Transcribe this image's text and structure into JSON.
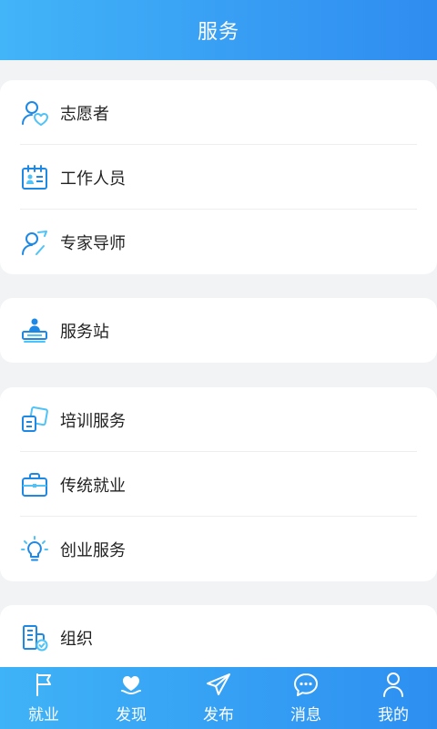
{
  "header": {
    "title": "服务"
  },
  "groups": [
    {
      "items": [
        {
          "label": "志愿者",
          "icon": "volunteer-icon"
        },
        {
          "label": "工作人员",
          "icon": "staff-badge-icon"
        },
        {
          "label": "专家导师",
          "icon": "expert-mentor-icon"
        }
      ]
    },
    {
      "items": [
        {
          "label": "服务站",
          "icon": "service-station-icon"
        }
      ]
    },
    {
      "items": [
        {
          "label": "培训服务",
          "icon": "training-icon"
        },
        {
          "label": "传统就业",
          "icon": "briefcase-icon"
        },
        {
          "label": "创业服务",
          "icon": "lightbulb-icon"
        }
      ]
    },
    {
      "items": [
        {
          "label": "组织",
          "icon": "organization-icon"
        }
      ]
    }
  ],
  "tabbar": {
    "tabs": [
      {
        "label": "就业",
        "icon": "flag-icon"
      },
      {
        "label": "发现",
        "icon": "heart-hand-icon"
      },
      {
        "label": "发布",
        "icon": "send-icon"
      },
      {
        "label": "消息",
        "icon": "message-icon"
      },
      {
        "label": "我的",
        "icon": "user-icon"
      }
    ]
  },
  "colors": {
    "accent": "#2f8cf0",
    "icon_blue": "#1e88e5",
    "icon_light": "#4fc3f7"
  }
}
